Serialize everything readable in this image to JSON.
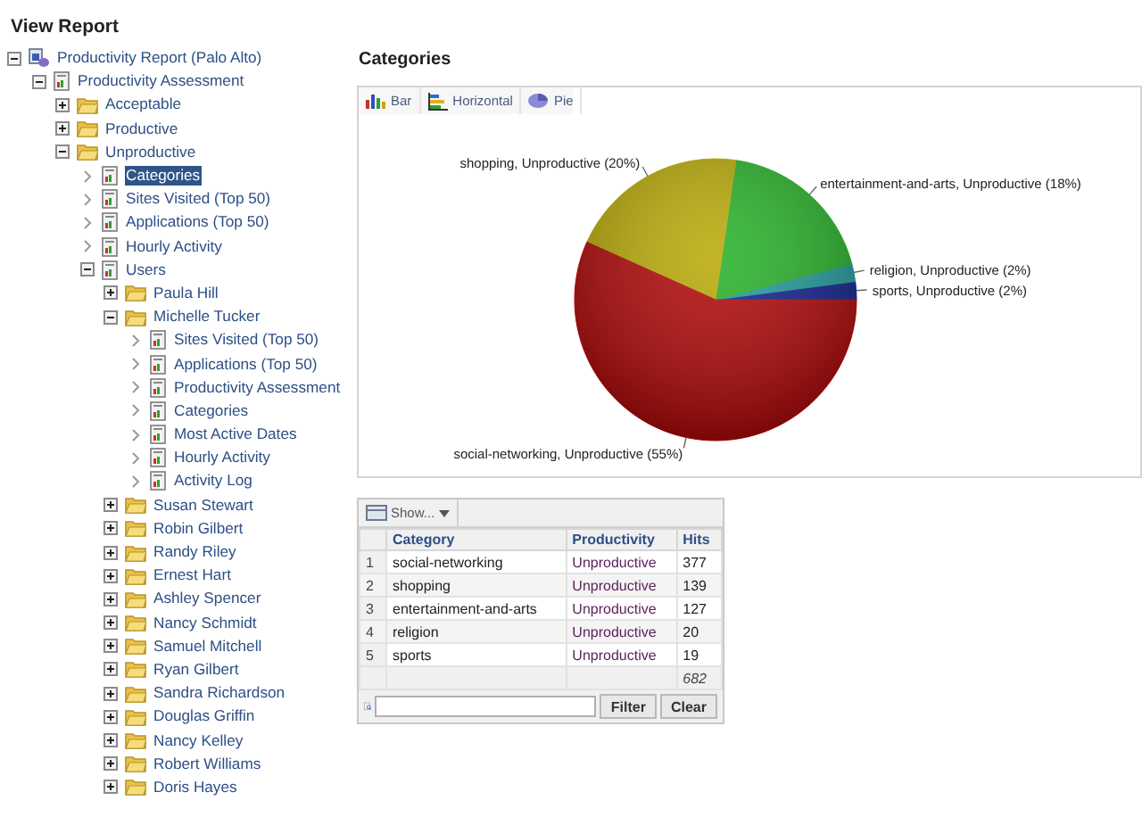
{
  "title": "View Report",
  "tree": [
    {
      "label": "Productivity Report (Palo Alto)",
      "kind": "root",
      "expanded": true,
      "selected": false,
      "children": [
        {
          "label": "Productivity Assessment",
          "kind": "report",
          "expanded": true,
          "selected": false,
          "children": [
            {
              "label": "Acceptable",
              "kind": "folder",
              "expanded": false,
              "selected": false
            },
            {
              "label": "Productive",
              "kind": "folder",
              "expanded": false,
              "selected": false
            },
            {
              "label": "Unproductive",
              "kind": "folder",
              "expanded": true,
              "selected": false,
              "children": [
                {
                  "label": "Categories",
                  "kind": "leaf",
                  "expanded": false,
                  "selected": true
                },
                {
                  "label": "Sites Visited (Top 50)",
                  "kind": "leaf",
                  "expanded": false,
                  "selected": false
                },
                {
                  "label": "Applications (Top 50)",
                  "kind": "leaf",
                  "expanded": false,
                  "selected": false
                },
                {
                  "label": "Hourly Activity",
                  "kind": "leaf",
                  "expanded": false,
                  "selected": false
                },
                {
                  "label": "Users",
                  "kind": "report",
                  "expanded": true,
                  "selected": false,
                  "children": [
                    {
                      "label": "Paula Hill",
                      "kind": "folder",
                      "expanded": false,
                      "selected": false
                    },
                    {
                      "label": "Michelle Tucker",
                      "kind": "folder",
                      "expanded": true,
                      "selected": false,
                      "children": [
                        {
                          "label": "Sites Visited (Top 50)",
                          "kind": "leaf",
                          "expanded": false,
                          "selected": false
                        },
                        {
                          "label": "Applications (Top 50)",
                          "kind": "leaf",
                          "expanded": false,
                          "selected": false
                        },
                        {
                          "label": "Productivity Assessment",
                          "kind": "leaf",
                          "expanded": false,
                          "selected": false
                        },
                        {
                          "label": "Categories",
                          "kind": "leaf",
                          "expanded": false,
                          "selected": false
                        },
                        {
                          "label": "Most Active Dates",
                          "kind": "leaf",
                          "expanded": false,
                          "selected": false
                        },
                        {
                          "label": "Hourly Activity",
                          "kind": "leaf",
                          "expanded": false,
                          "selected": false
                        },
                        {
                          "label": "Activity Log",
                          "kind": "leaf",
                          "expanded": false,
                          "selected": false
                        }
                      ]
                    },
                    {
                      "label": "Susan Stewart",
                      "kind": "folder",
                      "expanded": false,
                      "selected": false
                    },
                    {
                      "label": "Robin Gilbert",
                      "kind": "folder",
                      "expanded": false,
                      "selected": false
                    },
                    {
                      "label": "Randy Riley",
                      "kind": "folder",
                      "expanded": false,
                      "selected": false
                    },
                    {
                      "label": "Ernest Hart",
                      "kind": "folder",
                      "expanded": false,
                      "selected": false
                    },
                    {
                      "label": "Ashley Spencer",
                      "kind": "folder",
                      "expanded": false,
                      "selected": false
                    },
                    {
                      "label": "Nancy Schmidt",
                      "kind": "folder",
                      "expanded": false,
                      "selected": false
                    },
                    {
                      "label": "Samuel Mitchell",
                      "kind": "folder",
                      "expanded": false,
                      "selected": false
                    },
                    {
                      "label": "Ryan Gilbert",
                      "kind": "folder",
                      "expanded": false,
                      "selected": false
                    },
                    {
                      "label": "Sandra Richardson",
                      "kind": "folder",
                      "expanded": false,
                      "selected": false
                    },
                    {
                      "label": "Douglas Griffin",
                      "kind": "folder",
                      "expanded": false,
                      "selected": false
                    },
                    {
                      "label": "Nancy Kelley",
                      "kind": "folder",
                      "expanded": false,
                      "selected": false
                    },
                    {
                      "label": "Robert Williams",
                      "kind": "folder",
                      "expanded": false,
                      "selected": false
                    },
                    {
                      "label": "Doris Hayes",
                      "kind": "folder",
                      "expanded": false,
                      "selected": false
                    }
                  ]
                }
              ]
            }
          ]
        }
      ]
    }
  ],
  "report": {
    "heading": "Categories",
    "chart_types": [
      {
        "label": "Bar",
        "kind": "bar"
      },
      {
        "label": "Horizontal",
        "kind": "horizontal"
      },
      {
        "label": "Pie",
        "kind": "pie"
      }
    ],
    "chart_data": {
      "type": "pie",
      "categories": [
        "sports, Unproductive (2%)",
        "religion, Unproductive (2%)",
        "entertainment-and-arts, Unproductive (18%)",
        "shopping, Unproductive (20%)",
        "social-networking, Unproductive (55%)"
      ],
      "values": [
        2,
        2,
        18,
        20,
        55
      ]
    },
    "table": {
      "show_button": "Show...",
      "columns": [
        "Category",
        "Productivity",
        "Hits"
      ],
      "rows": [
        {
          "number": "1",
          "cells": [
            "social-networking",
            "Unproductive",
            "377"
          ]
        },
        {
          "number": "2",
          "cells": [
            "shopping",
            "Unproductive",
            "139"
          ]
        },
        {
          "number": "3",
          "cells": [
            "entertainment-and-arts",
            "Unproductive",
            "127"
          ]
        },
        {
          "number": "4",
          "cells": [
            "religion",
            "Unproductive",
            "20"
          ]
        },
        {
          "number": "5",
          "cells": [
            "sports",
            "Unproductive",
            "19"
          ]
        }
      ],
      "total": "682",
      "filter_button": "Filter",
      "clear_button": "Clear"
    }
  }
}
